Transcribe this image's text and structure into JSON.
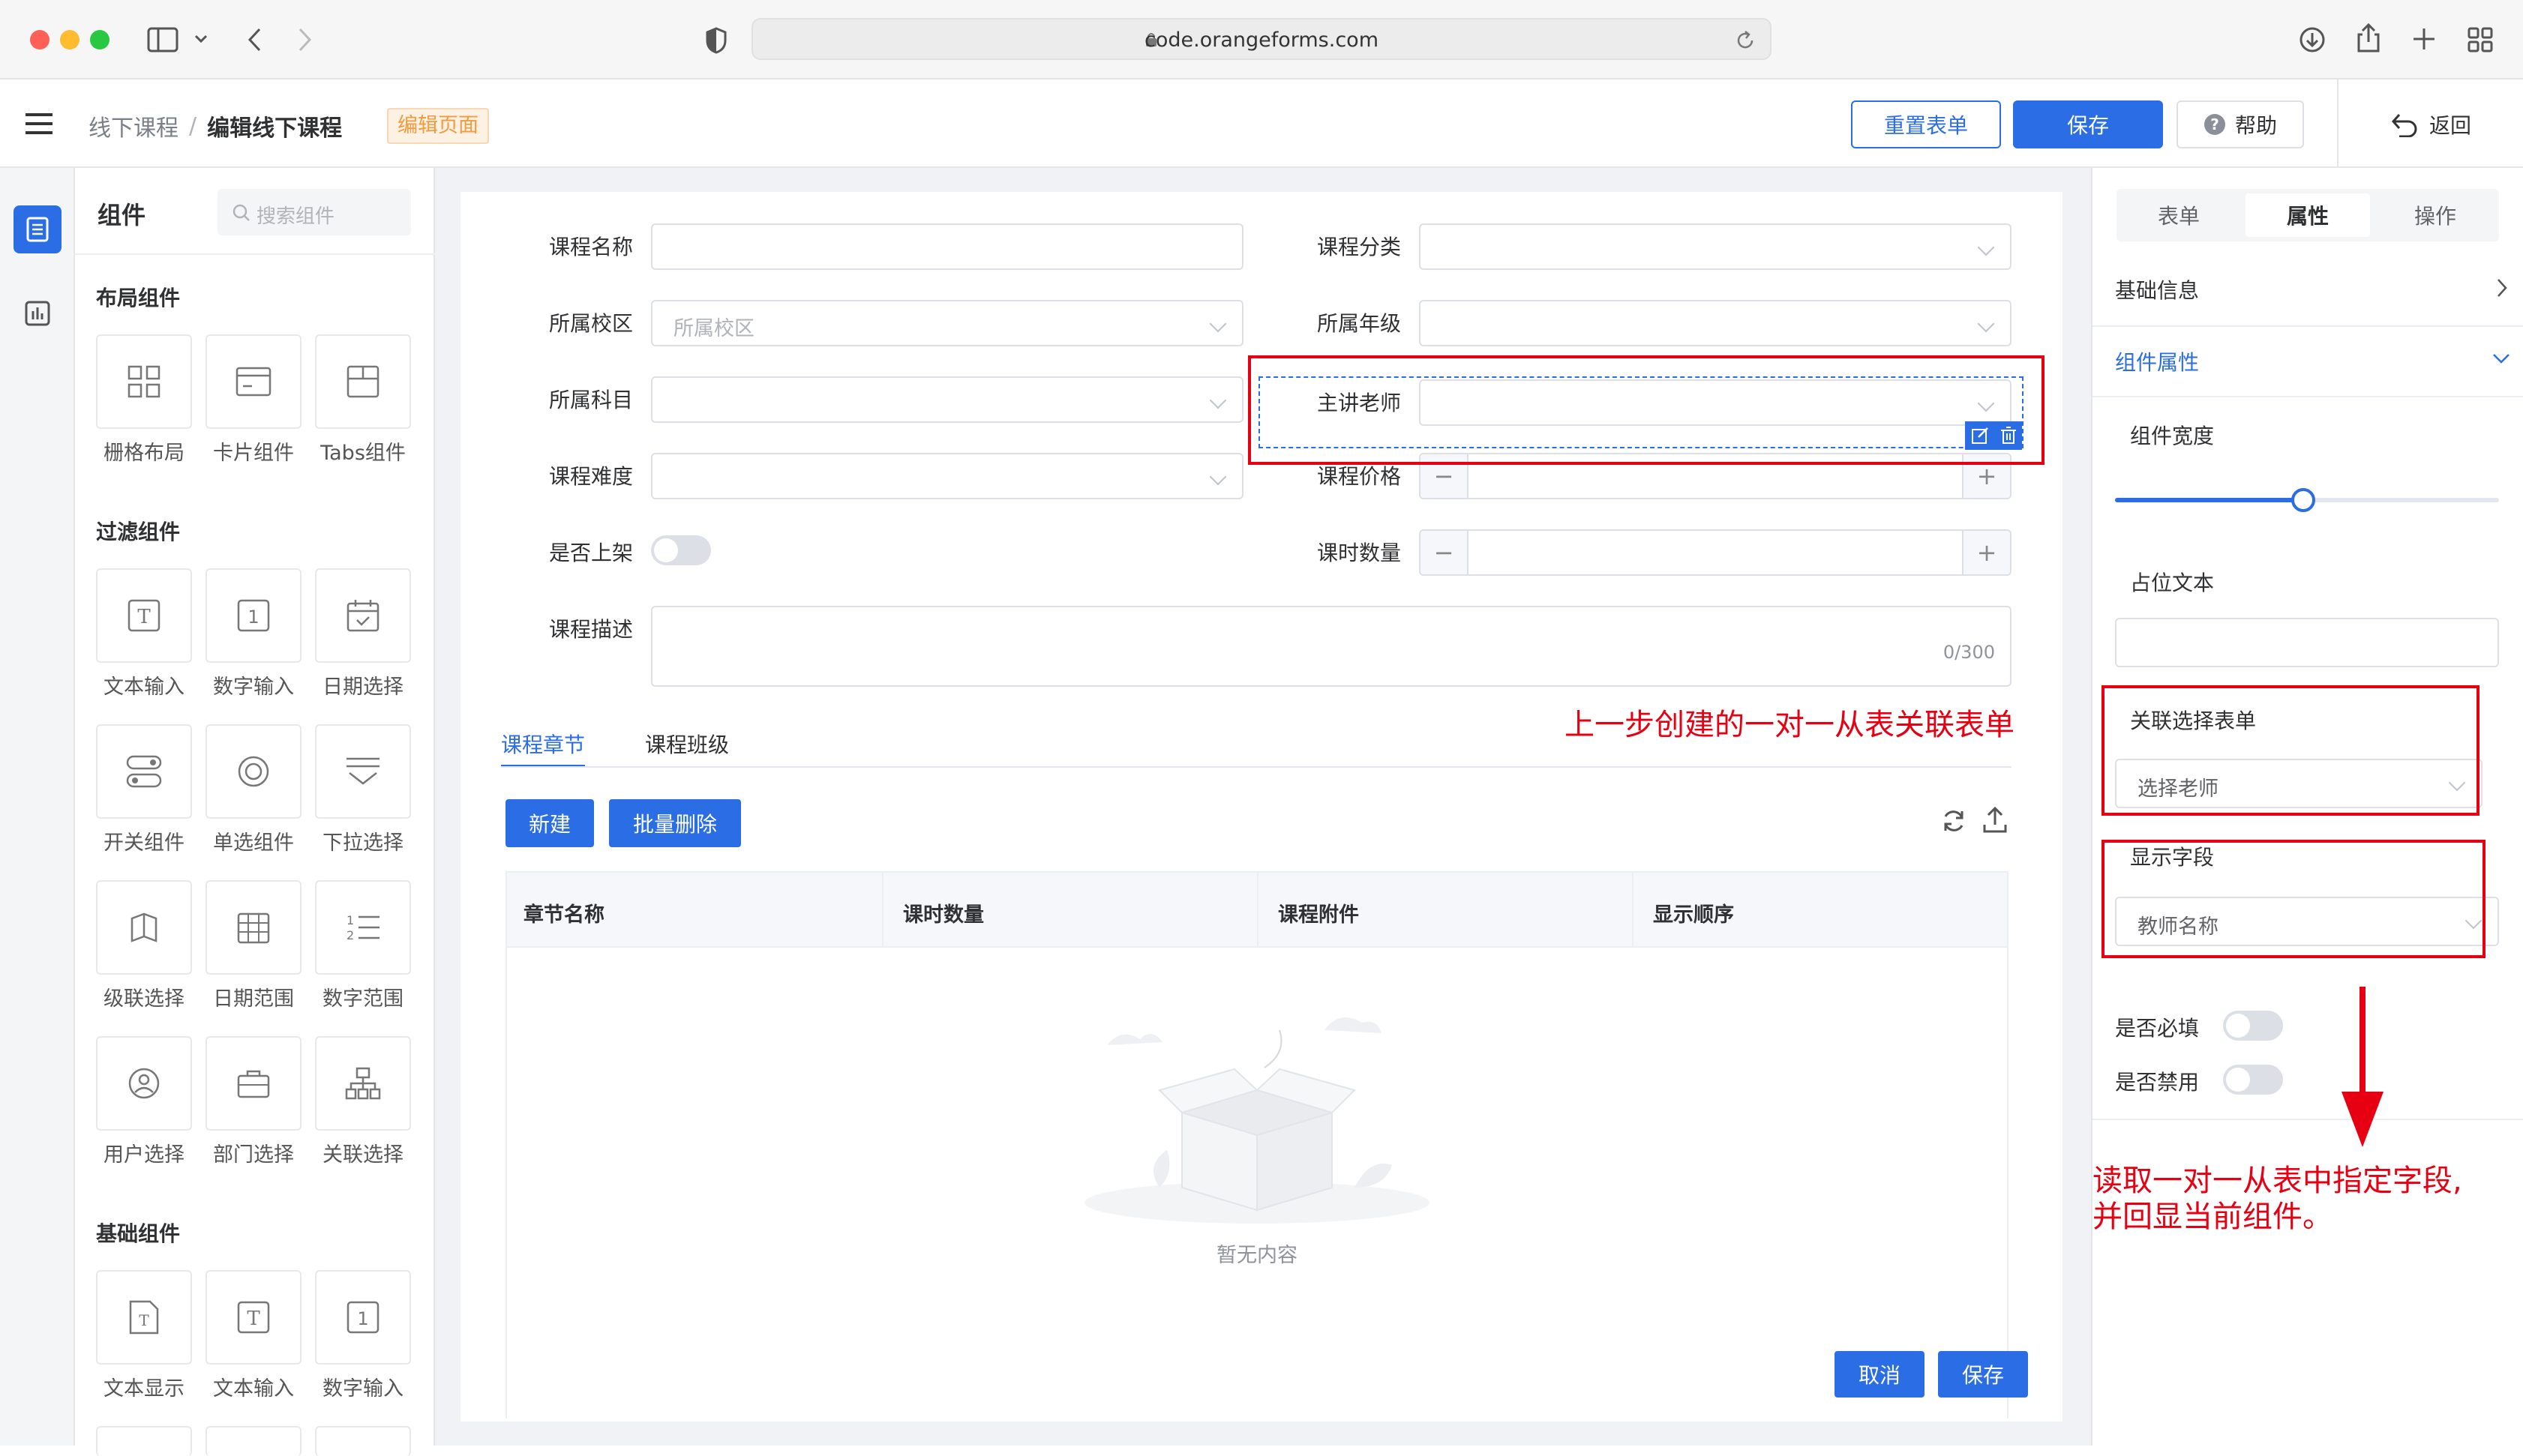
{
  "browser": {
    "url": "code.orangeforms.com"
  },
  "header": {
    "breadcrumb_parent": "线下课程",
    "breadcrumb_sep": "/",
    "breadcrumb_current": "编辑线下课程",
    "page_badge": "编辑页面",
    "reset_label": "重置表单",
    "save_label": "保存",
    "help_label": "帮助",
    "back_label": "返回"
  },
  "components_panel": {
    "title": "组件",
    "search_placeholder": "搜索组件",
    "sections": [
      {
        "title": "布局组件",
        "items": [
          "栅格布局",
          "卡片组件",
          "Tabs组件"
        ]
      },
      {
        "title": "过滤组件",
        "items": [
          "文本输入",
          "数字输入",
          "日期选择",
          "开关组件",
          "单选组件",
          "下拉选择",
          "级联选择",
          "日期范围",
          "数字范围",
          "用户选择",
          "部门选择",
          "关联选择"
        ]
      },
      {
        "title": "基础组件",
        "items": [
          "文本显示",
          "文本输入",
          "数字输入"
        ]
      }
    ]
  },
  "form": {
    "fields": {
      "course_name": "课程名称",
      "course_category": "课程分类",
      "campus": "所属校区",
      "campus_placeholder": "所属校区",
      "grade": "所属年级",
      "subject": "所属科目",
      "teacher": "主讲老师",
      "difficulty": "课程难度",
      "price": "课程价格",
      "on_shelf": "是否上架",
      "hours": "课时数量",
      "description": "课程描述",
      "desc_counter": "0/300"
    },
    "tabs": [
      "课程章节",
      "课程班级"
    ],
    "new_label": "新建",
    "batch_delete_label": "批量删除",
    "table": {
      "columns": [
        "章节名称",
        "课时数量",
        "课程附件",
        "显示顺序"
      ],
      "empty_text": "暂无内容"
    },
    "cancel_label": "取消",
    "save_label": "保存"
  },
  "properties_panel": {
    "tabs": [
      "表单",
      "属性",
      "操作"
    ],
    "active_tab": "属性",
    "basic_info": "基础信息",
    "component_props": "组件属性",
    "width_label": "组件宽度",
    "width_value_fraction": 0.49,
    "placeholder_label": "占位文本",
    "relation_form_label": "关联选择表单",
    "relation_form_value": "选择老师",
    "display_field_label": "显示字段",
    "display_field_value": "教师名称",
    "required_label": "是否必填",
    "disabled_label": "是否禁用"
  },
  "annotations": {
    "note1": "上一步创建的一对一从表关联表单",
    "note2_line1": "读取一对一从表中指定字段,",
    "note2_line2": "并回显当前组件。"
  },
  "colors": {
    "primary": "#2b6de5",
    "annotation": "#e60012",
    "badge": "#f5a04a"
  }
}
